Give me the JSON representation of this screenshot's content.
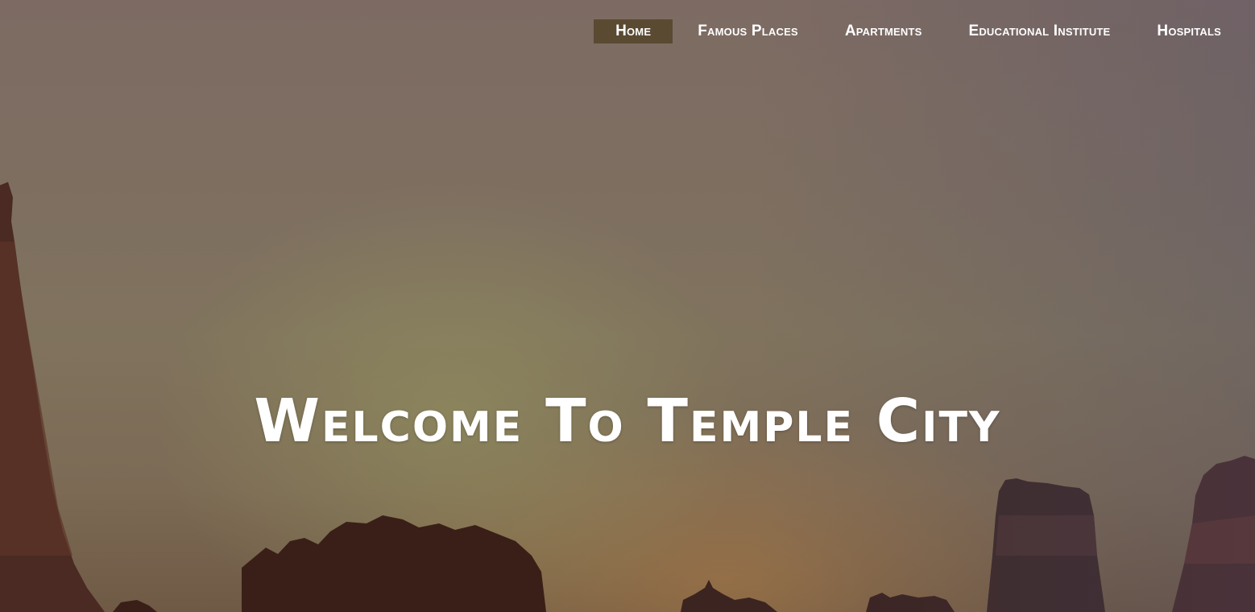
{
  "nav": {
    "items": [
      {
        "label": "Home",
        "active": true
      },
      {
        "label": "Famous Places",
        "active": false
      },
      {
        "label": "Apartments",
        "active": false
      },
      {
        "label": "Educational Institute",
        "active": false
      },
      {
        "label": "Hospitals",
        "active": false
      }
    ],
    "active_bg": "#5a4a32",
    "text_color": "#ffffff"
  },
  "hero": {
    "headline": "Welcome To Temple City",
    "background": "temple-skyline-sunset-photo"
  }
}
